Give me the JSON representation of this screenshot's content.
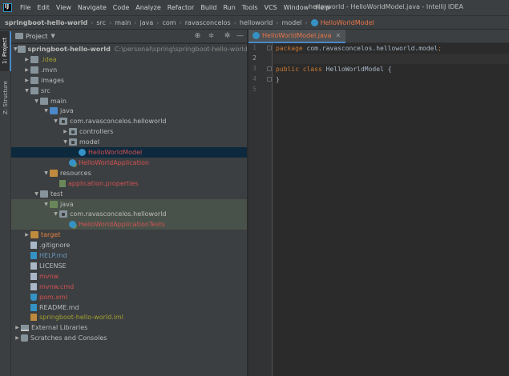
{
  "menubar": {
    "items": [
      "File",
      "Edit",
      "View",
      "Navigate",
      "Code",
      "Analyze",
      "Refactor",
      "Build",
      "Run",
      "Tools",
      "VCS",
      "Window",
      "Help"
    ],
    "window_title": "hello-world - HelloWorldModel.java - IntelliJ IDEA"
  },
  "breadcrumbs": {
    "project": "springboot-hello-world",
    "items": [
      "src",
      "main",
      "java",
      "com",
      "ravasconcelos",
      "helloworld",
      "model"
    ],
    "active": "HelloWorldModel"
  },
  "toolstrip": {
    "project_tab": "1: Project",
    "structure_tab": "Z: Structure"
  },
  "project_panel": {
    "title": "Project",
    "icons": [
      "target-icon",
      "collapse-icon",
      "gear-icon",
      "hide-icon"
    ]
  },
  "tree": [
    {
      "label": "springboot-hello-world",
      "path": "C:\\personal\\spring\\springboot-hello-world",
      "depth": 0,
      "expanded": true,
      "icon": "module-folder-icon",
      "color": "default",
      "bold": true
    },
    {
      "label": ".idea",
      "depth": 1,
      "expanded": false,
      "icon": "folder-icon",
      "color": "olive"
    },
    {
      "label": ".mvn",
      "depth": 1,
      "expanded": false,
      "icon": "folder-icon",
      "color": "default"
    },
    {
      "label": "images",
      "depth": 1,
      "expanded": false,
      "icon": "folder-icon",
      "color": "default"
    },
    {
      "label": "src",
      "depth": 1,
      "expanded": true,
      "icon": "folder-icon",
      "color": "default"
    },
    {
      "label": "main",
      "depth": 2,
      "expanded": true,
      "icon": "folder-icon",
      "color": "default"
    },
    {
      "label": "java",
      "depth": 3,
      "expanded": true,
      "icon": "source-folder-icon",
      "color": "default"
    },
    {
      "label": "com.ravasconcelos.helloworld",
      "depth": 4,
      "expanded": true,
      "icon": "package-icon",
      "color": "default"
    },
    {
      "label": "controllers",
      "depth": 5,
      "expanded": false,
      "icon": "package-icon",
      "color": "default"
    },
    {
      "label": "model",
      "depth": 5,
      "expanded": true,
      "icon": "package-icon",
      "color": "default"
    },
    {
      "label": "HelloWorldModel",
      "depth": 6,
      "leaf": true,
      "icon": "class-icon",
      "color": "red",
      "selected": true
    },
    {
      "label": "HelloWorldApplication",
      "depth": 5,
      "leaf": true,
      "icon": "spring-class-icon",
      "color": "red"
    },
    {
      "label": "resources",
      "depth": 3,
      "expanded": true,
      "icon": "resources-folder-icon",
      "color": "default"
    },
    {
      "label": "application.properties",
      "depth": 4,
      "leaf": true,
      "icon": "properties-file-icon",
      "color": "red"
    },
    {
      "label": "test",
      "depth": 2,
      "expanded": true,
      "icon": "folder-icon",
      "color": "default"
    },
    {
      "label": "java",
      "depth": 3,
      "expanded": true,
      "icon": "test-folder-icon",
      "color": "default",
      "test": true
    },
    {
      "label": "com.ravasconcelos.helloworld",
      "depth": 4,
      "expanded": true,
      "icon": "package-icon",
      "color": "default",
      "test": true
    },
    {
      "label": "HelloWorldApplicationTests",
      "depth": 5,
      "leaf": true,
      "icon": "spring-class-icon",
      "color": "red",
      "test": true
    },
    {
      "label": "target",
      "depth": 1,
      "expanded": false,
      "icon": "excluded-folder-icon",
      "color": "orange"
    },
    {
      "label": ".gitignore",
      "depth": 1,
      "leaf": true,
      "icon": "gitignore-file-icon",
      "color": "default"
    },
    {
      "label": "HELP.md",
      "depth": 1,
      "leaf": true,
      "icon": "markdown-file-icon",
      "color": "blue"
    },
    {
      "label": "LICENSE",
      "depth": 1,
      "leaf": true,
      "icon": "text-file-icon",
      "color": "default"
    },
    {
      "label": "mvnw",
      "depth": 1,
      "leaf": true,
      "icon": "text-file-icon",
      "color": "red"
    },
    {
      "label": "mvnw.cmd",
      "depth": 1,
      "leaf": true,
      "icon": "cmd-file-icon",
      "color": "red"
    },
    {
      "label": "pom.xml",
      "depth": 1,
      "leaf": true,
      "icon": "maven-file-icon",
      "color": "red"
    },
    {
      "label": "README.md",
      "depth": 1,
      "leaf": true,
      "icon": "markdown-file-icon",
      "color": "default"
    },
    {
      "label": "springboot-hello-world.iml",
      "depth": 1,
      "leaf": true,
      "icon": "iml-file-icon",
      "color": "olive"
    },
    {
      "label": "External Libraries",
      "depth": 0,
      "expanded": false,
      "icon": "library-icon",
      "color": "default"
    },
    {
      "label": "Scratches and Consoles",
      "depth": 0,
      "expanded": false,
      "icon": "scratch-icon",
      "color": "default"
    }
  ],
  "editor": {
    "tab_label": "HelloWorldModel.java",
    "lines": [
      "1",
      "2",
      "3",
      "4",
      "5"
    ],
    "code": {
      "line1_kw": "package",
      "line1_pkg": " com.ravasconcelos.helloworld.model",
      "line1_semi": ";",
      "line3_kw1": "public",
      "line3_kw2": " class",
      "line3_name": " HelloWorldModel",
      "line3_brace": " {",
      "line4_brace": "}"
    }
  },
  "colors": {
    "default": "#bbbbbb",
    "red": "#d25252",
    "orange": "#e0813f",
    "blue": "#6897bb",
    "olive": "#a0a030",
    "keyword": "#cc7832"
  }
}
